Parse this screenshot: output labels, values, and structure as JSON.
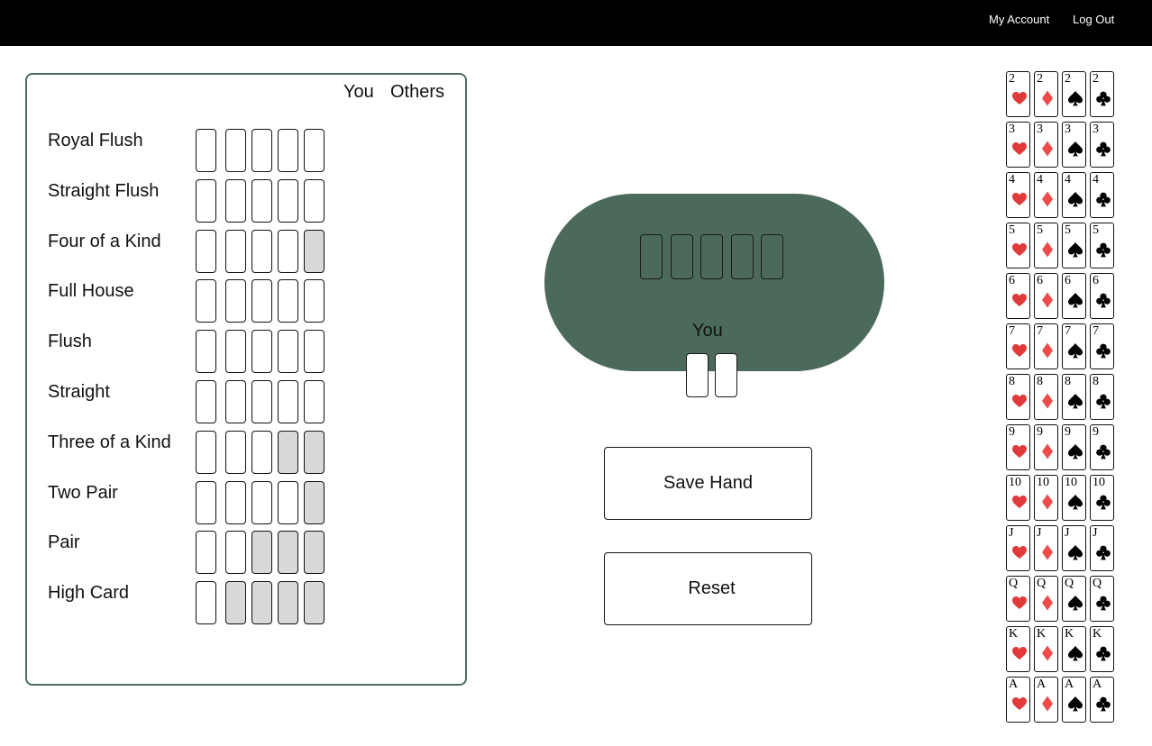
{
  "nav": {
    "account": "My Account",
    "logout": "Log Out"
  },
  "hands_panel": {
    "col_you": "You",
    "col_others": "Others",
    "rows": [
      {
        "name": "Royal Flush",
        "filled_slots": 0
      },
      {
        "name": "Straight Flush",
        "filled_slots": 0
      },
      {
        "name": "Four of a Kind",
        "filled_slots": 1
      },
      {
        "name": "Full House",
        "filled_slots": 0
      },
      {
        "name": "Flush",
        "filled_slots": 0
      },
      {
        "name": "Straight",
        "filled_slots": 0
      },
      {
        "name": "Three of a Kind",
        "filled_slots": 2
      },
      {
        "name": "Two Pair",
        "filled_slots": 1
      },
      {
        "name": "Pair",
        "filled_slots": 3
      },
      {
        "name": "High Card",
        "filled_slots": 4
      }
    ]
  },
  "table": {
    "you_label": "You",
    "board_slots": 5,
    "hole_slots": 2
  },
  "buttons": {
    "save": "Save Hand",
    "reset": "Reset"
  },
  "deck": {
    "ranks": [
      "2",
      "3",
      "4",
      "5",
      "6",
      "7",
      "8",
      "9",
      "10",
      "J",
      "Q",
      "K",
      "A"
    ],
    "suits": [
      {
        "name": "hearts",
        "color": "#e03a3a"
      },
      {
        "name": "diamonds",
        "color": "#f04b4b"
      },
      {
        "name": "spades",
        "color": "#000000"
      },
      {
        "name": "clubs",
        "color": "#000000"
      }
    ]
  },
  "colors": {
    "felt": "#4c6a5c",
    "panel_border": "#4c6b5e",
    "filled_slot": "#d9d9d9"
  }
}
